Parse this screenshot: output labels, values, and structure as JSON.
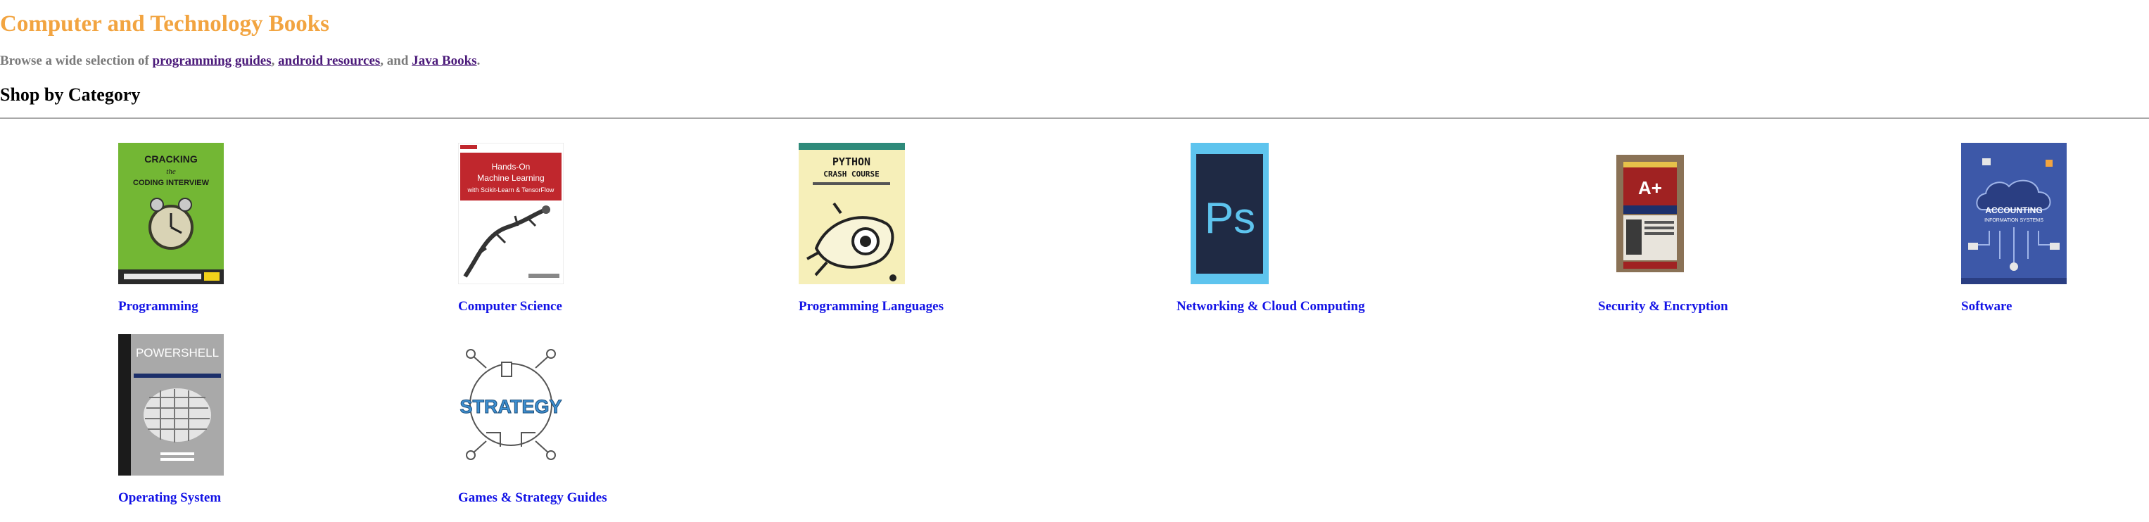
{
  "header": {
    "title": "Computer and Technology Books"
  },
  "intro": {
    "prefix": "Browse a wide selection of ",
    "link_1": "programming guides",
    "sep_1": ", ",
    "link_2": "android resources",
    "sep_2": ", and ",
    "link_3": "Java Books",
    "suffix": "."
  },
  "section": {
    "heading": "Shop by Category"
  },
  "categories": [
    {
      "label": "Programming",
      "cover_icon": "cracking-coding-interview-cover",
      "cover_text_1": "CRACKING",
      "cover_text_2": "the",
      "cover_text_3": "CODING INTERVIEW"
    },
    {
      "label": "Computer Science",
      "cover_icon": "hands-on-machine-learning-cover",
      "cover_text_1": "Hands-On",
      "cover_text_2": "Machine Learning",
      "cover_text_3": "with Scikit-Learn & TensorFlow"
    },
    {
      "label": "Programming Languages",
      "cover_icon": "python-crash-course-cover",
      "cover_text_1": "PYTHON",
      "cover_text_2": "CRASH COURSE"
    },
    {
      "label": "Networking & Cloud Computing",
      "cover_icon": "photoshop-logo-cover",
      "cover_text_1": "Ps"
    },
    {
      "label": "Security & Encryption",
      "cover_icon": "a-plus-certification-cover",
      "cover_text_1": "A+"
    },
    {
      "label": "Software",
      "cover_icon": "accounting-information-systems-cover",
      "cover_text_1": "ACCOUNTING",
      "cover_text_2": "INFORMATION SYSTEMS"
    },
    {
      "label": "Operating System",
      "cover_icon": "powershell-book-cover",
      "cover_text_1": "POWERSHELL"
    },
    {
      "label": "Games & Strategy Guides",
      "cover_icon": "strategy-word-art-cover",
      "cover_text_1": "STRATEGY"
    }
  ],
  "colors": {
    "title": "#f2a440",
    "intro_text": "#7a7a7a",
    "intro_link": "#4b1a7a",
    "category_link": "#1313e6",
    "rule": "#a8a8a8"
  }
}
